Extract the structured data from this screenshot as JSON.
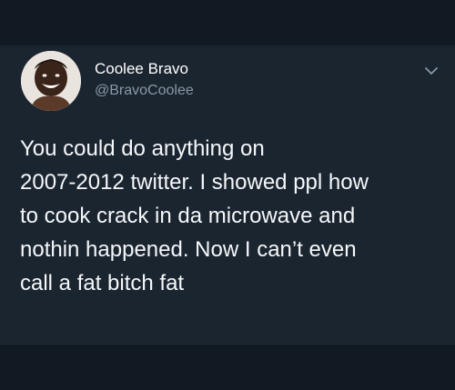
{
  "user": {
    "display_name": "Coolee Bravo",
    "handle": "@BravoCoolee"
  },
  "tweet": {
    "lines": [
      "You could do anything on",
      "2007-2012 twitter. I showed ppl how",
      "to cook crack in da microwave and",
      "nothin happened. Now I can’t even",
      "call a fat bitch fat"
    ]
  },
  "icons": {
    "avatar": "avatar",
    "menu": "chevron-down-icon"
  },
  "colors": {
    "background": "#141d26",
    "card": "#1b2530",
    "text": "#f5f8fa",
    "secondary_text": "#8899a6"
  }
}
